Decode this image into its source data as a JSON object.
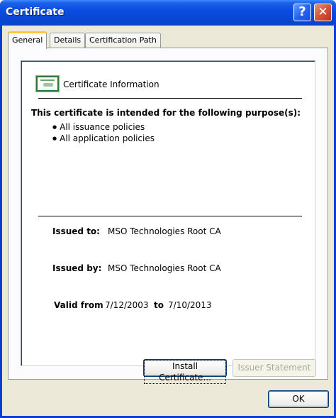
{
  "window": {
    "title": "Certificate",
    "help_glyph": "?",
    "close_glyph": "✕"
  },
  "tabs": [
    {
      "label": "General",
      "active": true
    },
    {
      "label": "Details",
      "active": false
    },
    {
      "label": "Certification Path",
      "active": false
    }
  ],
  "info": {
    "heading": "Certificate Information",
    "purpose_title": "This certificate is intended for the following purpose(s):",
    "purposes": [
      "All issuance policies",
      "All application policies"
    ]
  },
  "details": {
    "issued_to_label": "Issued to:",
    "issued_to_value": "MSO Technologies Root CA",
    "issued_by_label": "Issued by:",
    "issued_by_value": "MSO Technologies Root CA",
    "valid_from_label": "Valid from",
    "valid_from_value": "7/12/2003",
    "to_label": "to",
    "valid_to_value": "7/10/2013"
  },
  "buttons": {
    "install": "Install Certificate...",
    "issuer": "Issuer Statement",
    "ok": "OK"
  },
  "icons": {
    "certificate": "certificate-icon"
  },
  "colors": {
    "title_bar": "#0a46d4",
    "tab_highlight": "#ffc73c",
    "dialog_bg": "#ece9d8"
  }
}
